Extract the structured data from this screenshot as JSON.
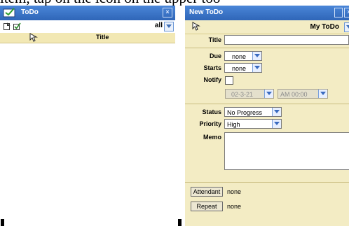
{
  "caption": "item, tap on the icon on the upper too",
  "left_window": {
    "title": "ToDo",
    "close": "×",
    "filter": {
      "value": "all"
    },
    "columns": {
      "title": "Title"
    }
  },
  "right_window": {
    "title": "New ToDo",
    "close": "×",
    "folder": "My ToDo",
    "fields": {
      "title_label": "Title",
      "title_value": "",
      "due_label": "Due",
      "due_value": "none",
      "starts_label": "Starts",
      "starts_value": "none",
      "notify_label": "Notify",
      "notify_checked": false,
      "notify_date": "02-3-21",
      "notify_time": "AM 00:00",
      "status_label": "Status",
      "status_value": "No Progress",
      "priority_label": "Priority",
      "priority_value": "High",
      "memo_label": "Memo",
      "memo_value": "",
      "attendant_button": "Attendant",
      "attendant_value": "none",
      "repeat_button": "Repeat",
      "repeat_value": "none"
    }
  },
  "colors": {
    "titlebar": "#3b72c4",
    "header_bg": "#f2e8b4",
    "form_bg": "#f3ecc4"
  }
}
